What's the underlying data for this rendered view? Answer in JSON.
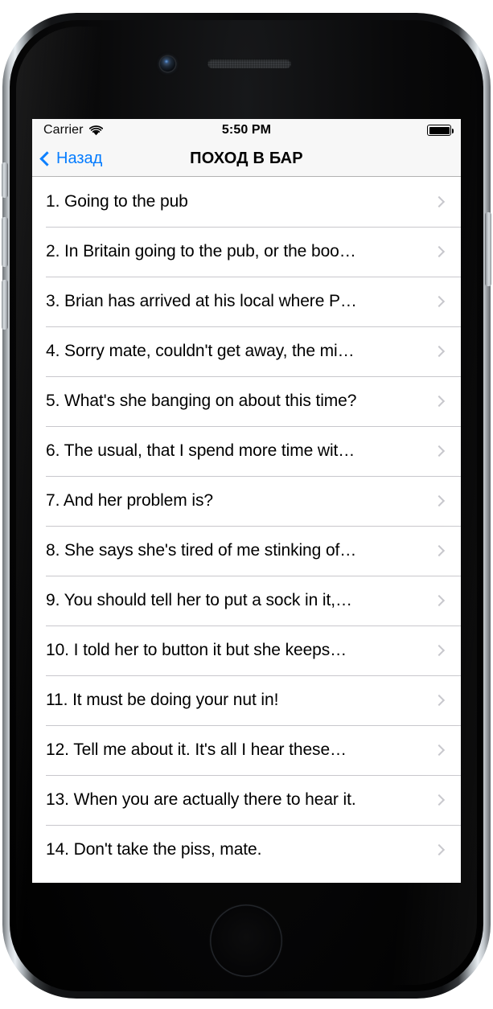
{
  "device": {
    "name": "iphone-6-space-gray",
    "camera": "front-camera",
    "speaker": "earpiece-speaker",
    "home_button": "home-button"
  },
  "status_bar": {
    "carrier": "Carrier",
    "wifi_icon": "wifi-icon",
    "time": "5:50 PM",
    "battery_icon": "battery-full-icon"
  },
  "nav_bar": {
    "back_label": "Назад",
    "back_icon": "chevron-left-icon",
    "title": "ПОХОД В БАР",
    "tint_color": "#007aff"
  },
  "list": {
    "disclosure_icon": "chevron-right-icon",
    "separator_color": "#c8c7cc",
    "rows": [
      {
        "label": "1. Going to the pub"
      },
      {
        "label": "2. In Britain going to the pub, or the boo…"
      },
      {
        "label": "3. Brian has arrived at his local where P…"
      },
      {
        "label": "4. Sorry mate, couldn't get away, the mi…"
      },
      {
        "label": "5. What's she banging on about this time?"
      },
      {
        "label": "6. The usual, that I spend more time wit…"
      },
      {
        "label": "7. And her problem is?"
      },
      {
        "label": "8. She says she's tired of me stinking of…"
      },
      {
        "label": "9. You should tell her to put a sock in it,…"
      },
      {
        "label": "10. I told her to button it but she keeps…"
      },
      {
        "label": "11. It must be doing your nut in!"
      },
      {
        "label": "12. Tell me about it. It's all I hear these…"
      },
      {
        "label": "13. When you are actually there to hear it."
      },
      {
        "label": "14. Don't take the piss, mate."
      }
    ]
  }
}
